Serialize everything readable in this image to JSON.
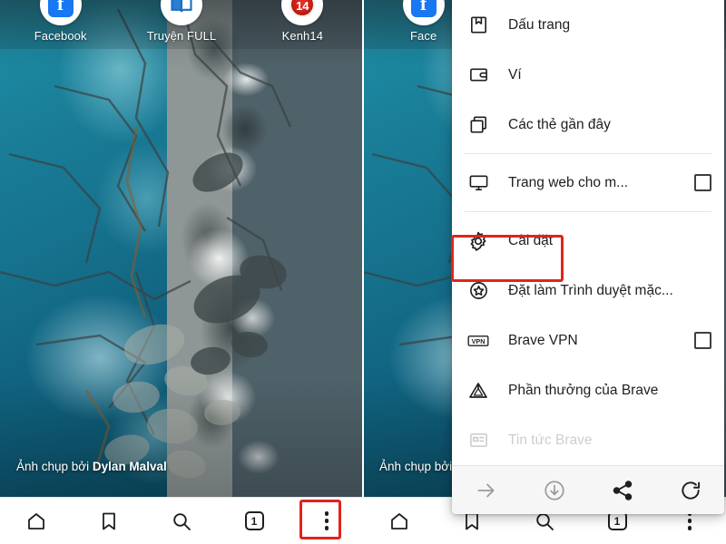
{
  "meta": {
    "description": "Brave browser on Android — left phone shows new tab page with overflow menu closed, right phone shows overflow menu opened with 'Cài đặt' highlighted"
  },
  "left_phone": {
    "home_shortcuts": [
      {
        "label": "Facebook",
        "icon": "facebook-icon",
        "glyph": "f"
      },
      {
        "label": "Truyện FULL",
        "icon": "book-icon",
        "glyph": ""
      },
      {
        "label": "Kenh14",
        "icon": "kenh14-icon",
        "glyph": "14"
      }
    ],
    "photo_credit": {
      "prefix": "Ảnh chụp bởi",
      "author": "Dylan Malval"
    },
    "navbar": [
      {
        "name": "home",
        "icon": "home-icon",
        "label": ""
      },
      {
        "name": "bookmarks",
        "icon": "bookmark-icon",
        "label": ""
      },
      {
        "name": "search",
        "icon": "search-icon",
        "label": ""
      },
      {
        "name": "tabs",
        "icon": "tab-counter-icon",
        "label": "1"
      },
      {
        "name": "menu",
        "icon": "kebab-menu-icon",
        "label": ""
      }
    ],
    "highlight": {
      "target": "kebab-menu-icon",
      "color": "#e2231a"
    }
  },
  "right_phone": {
    "home_shortcuts": [
      {
        "label": "Face",
        "icon": "facebook-icon",
        "glyph": "f"
      }
    ],
    "photo_credit": {
      "prefix": "Ảnh chụp bởi",
      "author": ""
    },
    "menu": {
      "items": [
        {
          "label": "",
          "icon": "history-icon",
          "state": "clipped",
          "checkbox": false
        },
        {
          "label": "Dấu trang",
          "icon": "bookmark-ribbon-icon",
          "state": "normal",
          "checkbox": false
        },
        {
          "label": "Ví",
          "icon": "wallet-icon",
          "state": "normal",
          "checkbox": false
        },
        {
          "label": "Các thẻ gần đây",
          "icon": "recent-tabs-icon",
          "state": "normal",
          "checkbox": false
        },
        {
          "label": "Trang web cho m...",
          "icon": "desktop-site-icon",
          "state": "normal",
          "checkbox": true
        },
        {
          "label": "Cài đặt",
          "icon": "gear-icon",
          "state": "highlighted",
          "checkbox": false
        },
        {
          "label": "Đặt làm Trình duyệt mặc...",
          "icon": "star-badge-icon",
          "state": "normal",
          "checkbox": false
        },
        {
          "label": "Brave VPN",
          "icon": "vpn-icon",
          "state": "normal",
          "checkbox": true
        },
        {
          "label": "Phần thưởng của Brave",
          "icon": "brave-triangle-icon",
          "state": "normal",
          "checkbox": false
        },
        {
          "label": "Tin tức Brave",
          "icon": "news-icon",
          "state": "faded",
          "checkbox": false
        }
      ],
      "separator_after_indexes": [
        3,
        4
      ],
      "toolbar": [
        {
          "name": "forward",
          "icon": "arrow-forward-icon",
          "enabled": false
        },
        {
          "name": "download",
          "icon": "download-circle-icon",
          "enabled": false
        },
        {
          "name": "share",
          "icon": "share-icon",
          "enabled": true
        },
        {
          "name": "reload",
          "icon": "reload-icon",
          "enabled": true
        }
      ],
      "highlight": {
        "target": "Cài đặt",
        "color": "#e2231a"
      }
    },
    "navbar": [
      {
        "name": "home",
        "icon": "home-icon",
        "label": ""
      },
      {
        "name": "bookmarks",
        "icon": "bookmark-icon",
        "label": ""
      },
      {
        "name": "search",
        "icon": "search-icon",
        "label": ""
      },
      {
        "name": "tabs",
        "icon": "tab-counter-icon",
        "label": "1"
      },
      {
        "name": "menu",
        "icon": "kebab-menu-icon",
        "label": ""
      }
    ]
  },
  "colors": {
    "highlight": "#e2231a",
    "menu_bg": "#ffffff",
    "menu_text": "#1f1f1f",
    "toolbar_bg": "#f6f6f6",
    "ocean": "#15708c",
    "rock": "#c4c8c3"
  }
}
